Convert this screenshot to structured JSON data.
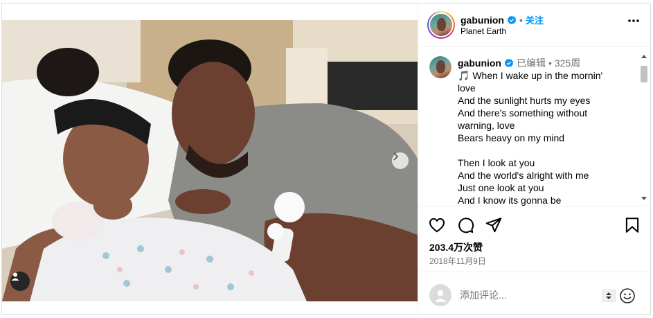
{
  "post": {
    "photo_alt": "",
    "carousel_next": "›"
  },
  "header": {
    "username": "gabunion",
    "separator": "•",
    "follow_label": "关注",
    "location": "Planet Earth"
  },
  "caption": {
    "username": "gabunion",
    "edited": "已编辑",
    "separator": "•",
    "age": "325周",
    "lines": [
      "🎵 When I wake up in the mornin'",
      "love",
      "And the sunlight hurts my eyes",
      "And there's something without",
      "warning, love",
      "Bears heavy on my mind",
      "",
      "Then I look at you",
      "And the world's alright with me",
      "Just one look at you",
      "And I know its gonna be"
    ]
  },
  "actions": {
    "like_icon": "heart-icon",
    "comment_icon": "comment-icon",
    "share_icon": "send-icon",
    "save_icon": "bookmark-icon",
    "likes": "203.4万次赞",
    "date": "2018年11月9日"
  },
  "comment": {
    "placeholder": "添加评论...",
    "emoji_icon": "smiley-icon"
  },
  "colors": {
    "accent": "#0095f6",
    "verified": "#0095f6",
    "muted": "#737373",
    "border": "#dbdbdb"
  }
}
